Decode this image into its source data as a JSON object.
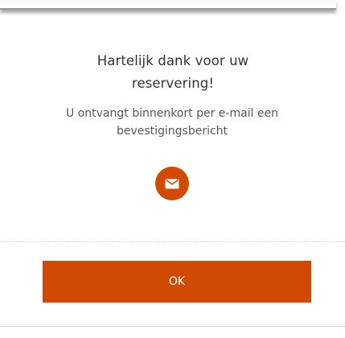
{
  "dialog": {
    "title_line1": "Hartelijk dank voor uw",
    "title_line2": "reservering!",
    "message_line1": "U ontvangt binnenkort per e-mail een",
    "message_line2": "bevestigingsbericht",
    "icon": "envelope-icon",
    "ok_label": "OK"
  },
  "colors": {
    "accent": "#d04a02",
    "title_text": "#333333",
    "body_text": "#555555",
    "background": "#ffffff"
  }
}
